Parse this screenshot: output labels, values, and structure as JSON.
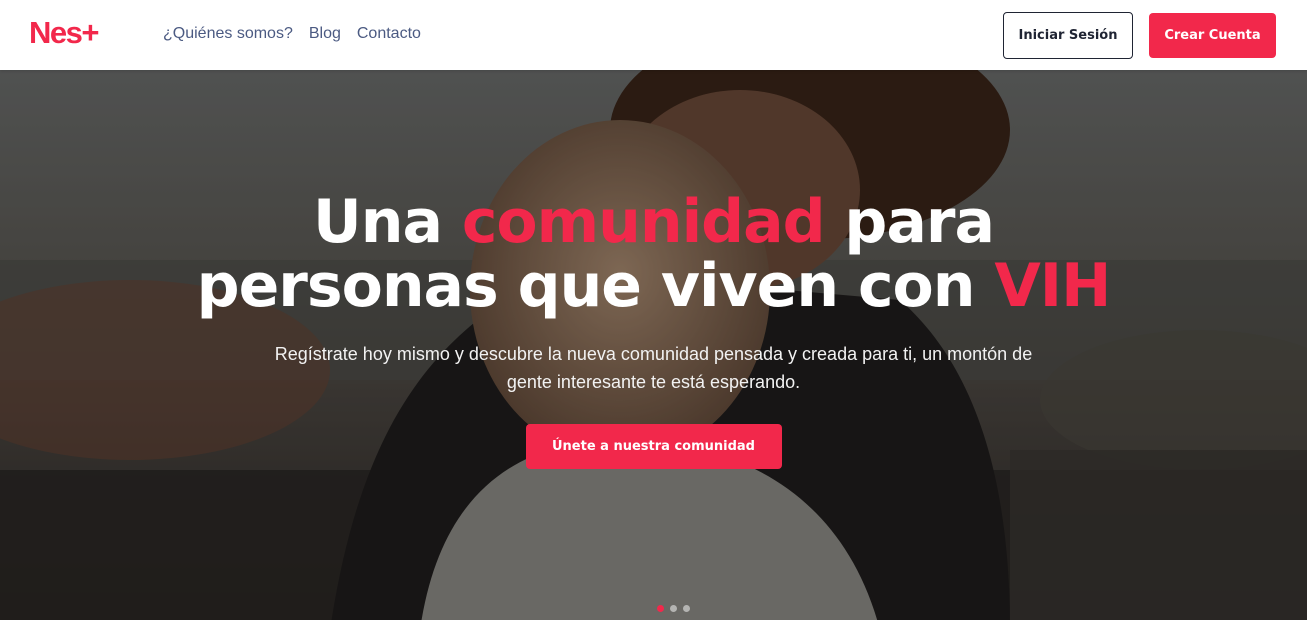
{
  "brand": {
    "logo_text": "Nes+",
    "accent_color": "#f2284b"
  },
  "nav": {
    "links": [
      "¿Quiénes somos?",
      "Blog",
      "Contacto"
    ],
    "login_label": "Iniciar Sesión",
    "signup_label": "Crear Cuenta"
  },
  "hero": {
    "headline": {
      "part1": "Una ",
      "accent1": "comunidad",
      "part2": " para personas que viven con ",
      "accent2": "VIH"
    },
    "subtitle": "Regístrate hoy mismo y descubre la nueva comunidad pensada y creada para ti, un montón de gente interesante te está esperando.",
    "cta_label": "Únete a nuestra comunidad",
    "background_image": "photo of two people embracing outdoors",
    "slide_count": 3,
    "active_slide": 1
  }
}
